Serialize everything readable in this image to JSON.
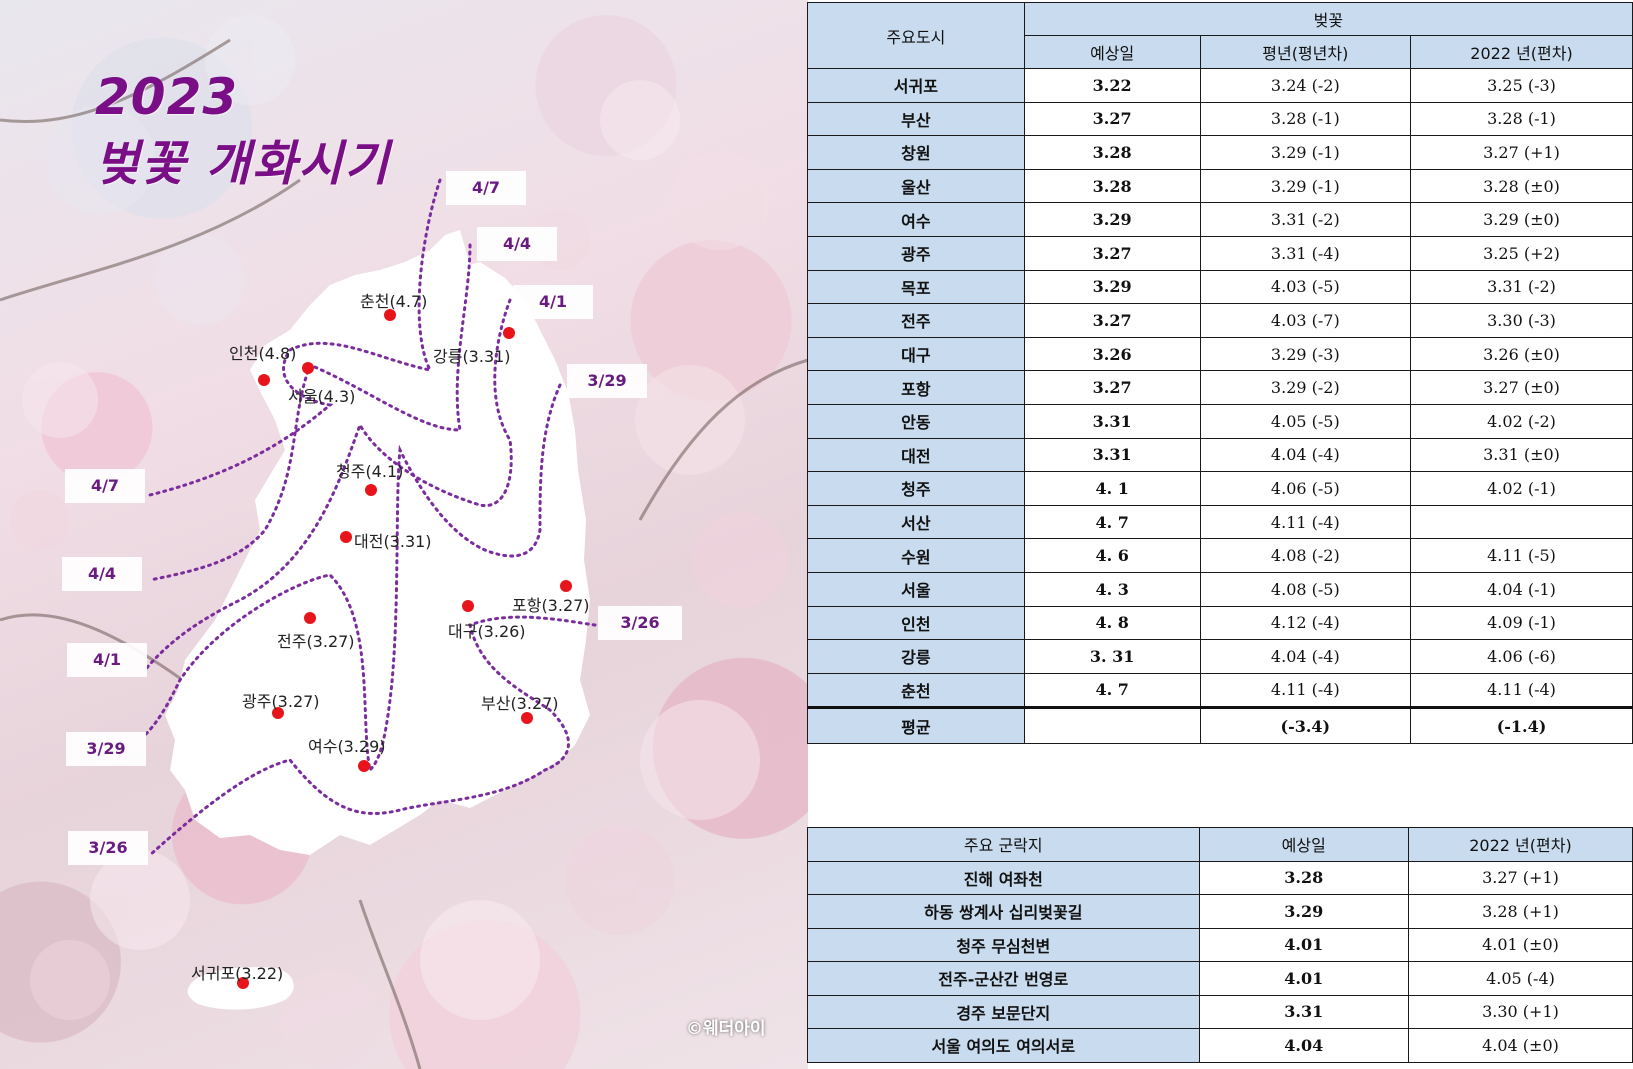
{
  "map": {
    "title_year": "2023",
    "title_sub": "벚꽃 개화시기",
    "copyright": "©웨더아이",
    "isoline_labels": [
      "4/7",
      "4/4",
      "4/1",
      "3/29",
      "4/7",
      "4/4",
      "4/1",
      "3/29",
      "3/26",
      "3/26"
    ],
    "cities": [
      {
        "name": "춘천(4.7)"
      },
      {
        "name": "인천(4.8)"
      },
      {
        "name": "서울(4.3)"
      },
      {
        "name": "강릉(3.31)"
      },
      {
        "name": "청주(4.1)"
      },
      {
        "name": "대전(3.31)"
      },
      {
        "name": "포항(3.27)"
      },
      {
        "name": "대구(3.26)"
      },
      {
        "name": "전주(3.27)"
      },
      {
        "name": "광주(3.27)"
      },
      {
        "name": "부산(3.27)"
      },
      {
        "name": "여수(3.29)"
      },
      {
        "name": "서귀포(3.22)"
      }
    ],
    "marker_color": "#e8141b",
    "isoline_color": "#7b2d9e",
    "title_color": "#7a0e86"
  },
  "table_main": {
    "header_city": "주요도시",
    "header_group": "벚꽃",
    "header_pred": "예상일",
    "header_normal": "평년(평년차)",
    "header_2022": "2022 년(편차)",
    "rows": [
      {
        "city": "서귀포",
        "pred": "3.22",
        "normal": "3.24 (-2)",
        "y2022": "3.25 (-3)"
      },
      {
        "city": "부산",
        "pred": "3.27",
        "normal": "3.28 (-1)",
        "y2022": "3.28 (-1)"
      },
      {
        "city": "창원",
        "pred": "3.28",
        "normal": "3.29 (-1)",
        "y2022": "3.27 (+1)"
      },
      {
        "city": "울산",
        "pred": "3.28",
        "normal": "3.29 (-1)",
        "y2022": "3.28 (±0)"
      },
      {
        "city": "여수",
        "pred": "3.29",
        "normal": "3.31 (-2)",
        "y2022": "3.29 (±0)"
      },
      {
        "city": "광주",
        "pred": "3.27",
        "normal": "3.31 (-4)",
        "y2022": "3.25 (+2)"
      },
      {
        "city": "목포",
        "pred": "3.29",
        "normal": "4.03 (-5)",
        "y2022": "3.31 (-2)"
      },
      {
        "city": "전주",
        "pred": "3.27",
        "normal": "4.03 (-7)",
        "y2022": "3.30 (-3)"
      },
      {
        "city": "대구",
        "pred": "3.26",
        "normal": "3.29 (-3)",
        "y2022": "3.26 (±0)"
      },
      {
        "city": "포항",
        "pred": "3.27",
        "normal": "3.29 (-2)",
        "y2022": "3.27 (±0)"
      },
      {
        "city": "안동",
        "pred": "3.31",
        "normal": "4.05 (-5)",
        "y2022": "4.02 (-2)"
      },
      {
        "city": "대전",
        "pred": "3.31",
        "normal": "4.04 (-4)",
        "y2022": "3.31 (±0)"
      },
      {
        "city": "청주",
        "pred": "4. 1",
        "normal": "4.06 (-5)",
        "y2022": "4.02 (-1)"
      },
      {
        "city": "서산",
        "pred": "4. 7",
        "normal": "4.11 (-4)",
        "y2022": ""
      },
      {
        "city": "수원",
        "pred": "4. 6",
        "normal": "4.08 (-2)",
        "y2022": "4.11 (-5)"
      },
      {
        "city": "서울",
        "pred": "4. 3",
        "normal": "4.08 (-5)",
        "y2022": "4.04 (-1)"
      },
      {
        "city": "인천",
        "pred": "4. 8",
        "normal": "4.12 (-4)",
        "y2022": "4.09 (-1)"
      },
      {
        "city": "강릉",
        "pred": "3. 31",
        "normal": "4.04 (-4)",
        "y2022": "4.06 (-6)"
      },
      {
        "city": "춘천",
        "pred": "4. 7",
        "normal": "4.11 (-4)",
        "y2022": "4.11 (-4)"
      }
    ],
    "avg_label": "평균",
    "avg_pred": "",
    "avg_normal": "(-3.4)",
    "avg_2022": "(-1.4)"
  },
  "table_spots": {
    "header_spot": "주요 군락지",
    "header_pred": "예상일",
    "header_2022": "2022 년(편차)",
    "rows": [
      {
        "spot": "진해 여좌천",
        "pred": "3.28",
        "y2022": "3.27 (+1)"
      },
      {
        "spot": "하동 쌍계사 십리벚꽃길",
        "pred": "3.29",
        "y2022": "3.28 (+1)"
      },
      {
        "spot": "청주 무심천변",
        "pred": "4.01",
        "y2022": "4.01 (±0)"
      },
      {
        "spot": "전주-군산간 번영로",
        "pred": "4.01",
        "y2022": "4.05 (-4)"
      },
      {
        "spot": "경주 보문단지",
        "pred": "3.31",
        "y2022": "3.30 (+1)"
      },
      {
        "spot": "서울 여의도 여의서로",
        "pred": "4.04",
        "y2022": "4.04 (±0)"
      }
    ]
  }
}
